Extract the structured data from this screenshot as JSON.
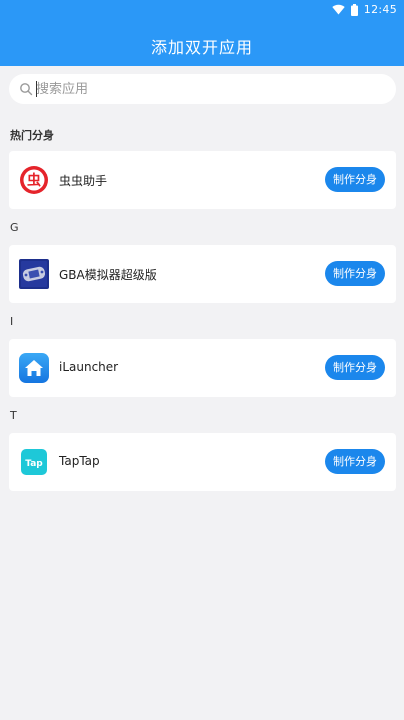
{
  "status_bar": {
    "time": "12:45"
  },
  "header": {
    "title": "添加双开应用"
  },
  "search": {
    "placeholder": "搜索应用"
  },
  "sections": [
    {
      "label": "热门分身",
      "items": [
        {
          "name": "虫虫助手",
          "icon": "chongchong-icon",
          "button": "制作分身"
        }
      ]
    },
    {
      "label": "G",
      "items": [
        {
          "name": "GBA模拟器超级版",
          "icon": "gba-emulator-icon",
          "button": "制作分身"
        }
      ]
    },
    {
      "label": "I",
      "items": [
        {
          "name": "iLauncher",
          "icon": "ilauncher-home-icon",
          "button": "制作分身"
        }
      ]
    },
    {
      "label": "T",
      "items": [
        {
          "name": "TapTap",
          "icon": "taptap-icon",
          "button": "制作分身"
        }
      ]
    }
  ],
  "icon_texts": {
    "chongchong": "虫",
    "taptap": "Tap"
  },
  "colors": {
    "primary": "#2b98f7",
    "button": "#1b87ec",
    "background": "#f2f2f4"
  }
}
